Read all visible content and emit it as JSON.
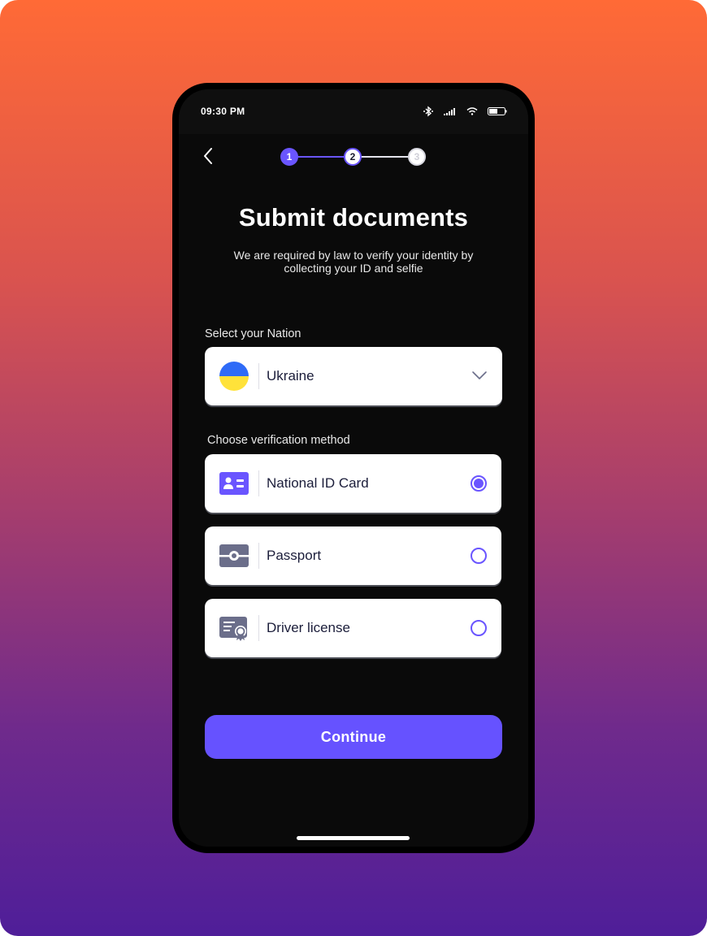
{
  "status_bar": {
    "time": "09:30 PM",
    "icons": [
      "bluetooth-icon",
      "signal-icon",
      "wifi-icon",
      "battery-icon"
    ],
    "battery_level_percent": 50
  },
  "header": {
    "back_icon": "chevron-left-icon",
    "stepper": {
      "current_step": 2,
      "total_steps": 3,
      "steps": [
        {
          "label": "1",
          "state": "completed"
        },
        {
          "label": "2",
          "state": "current"
        },
        {
          "label": "3",
          "state": "upcoming"
        }
      ]
    }
  },
  "main": {
    "title": "Submit documents",
    "subtitle": "We are required by law to verify your identity by collecting your ID and selfie",
    "nation": {
      "label": "Select your Nation",
      "selected": "Ukraine",
      "flag_icon": "ukraine-flag-icon",
      "flag_colors": [
        "#2f6bf7",
        "#ffe23a"
      ]
    },
    "verification": {
      "label": "Choose verification method",
      "options": [
        {
          "label": "National ID Card",
          "icon": "id-card-icon",
          "selected": true
        },
        {
          "label": "Passport",
          "icon": "passport-icon",
          "selected": false
        },
        {
          "label": "Driver license",
          "icon": "driver-license-icon",
          "selected": false
        }
      ]
    },
    "continue_label": "Continue"
  },
  "colors": {
    "accent": "#6652ff",
    "background_gradient_top": "#ff6a36",
    "background_gradient_bottom": "#4f1e99",
    "screen_bg": "#0a0a0a",
    "card_text": "#1b1d3a",
    "icon_inactive": "#6b6e8a"
  }
}
